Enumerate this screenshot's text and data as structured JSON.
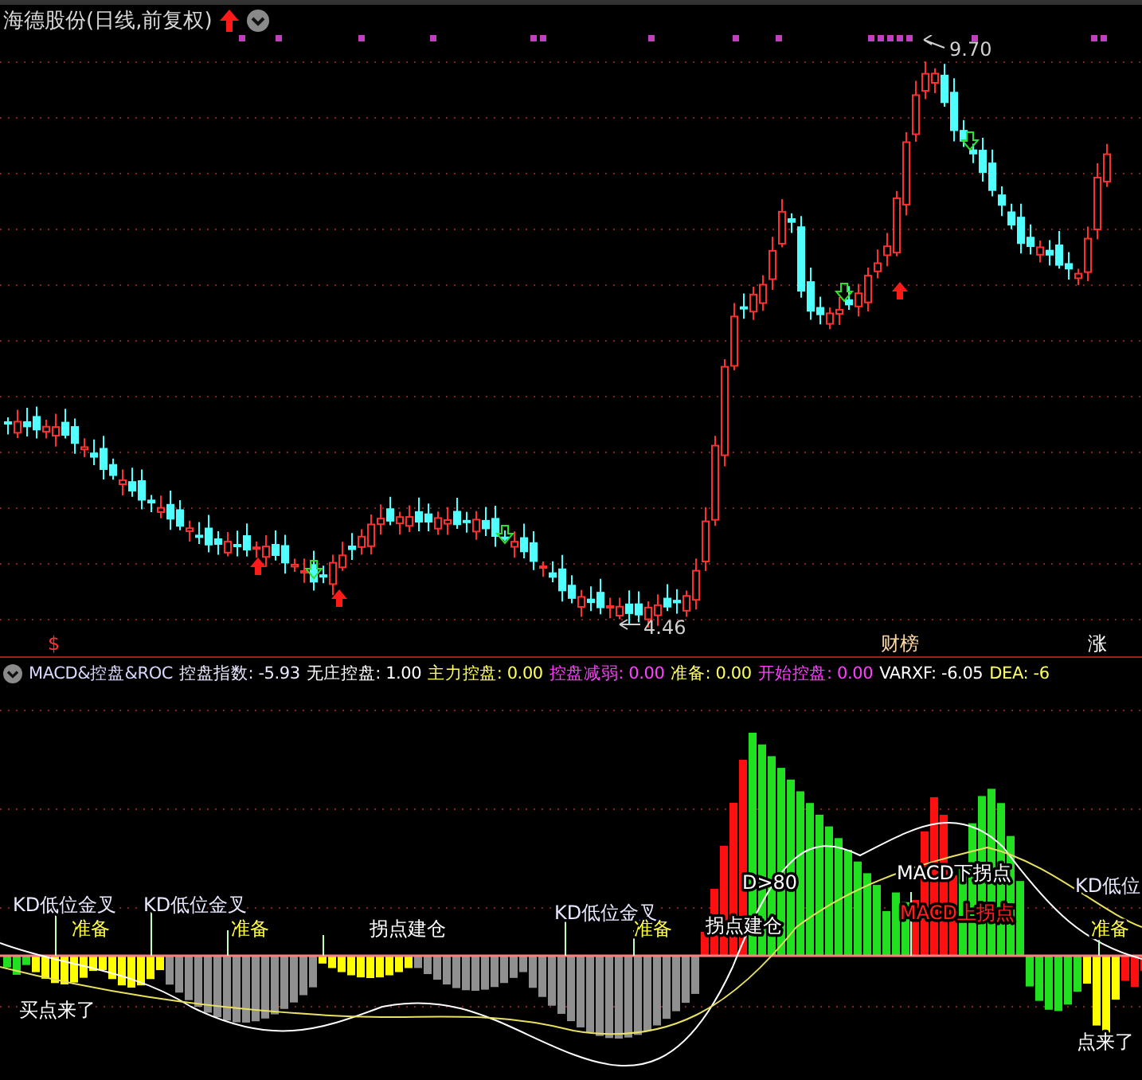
{
  "header": {
    "title": "海德股份(日线,前复权)"
  },
  "price_chart": {
    "high_label": "9.70",
    "low_label": "4.46",
    "event_marks": [
      {
        "text": "$",
        "color": "#ff3030"
      },
      {
        "text": "财榜",
        "color": "#ffd8a0"
      },
      {
        "text": "涨",
        "color": "#ffffff"
      }
    ]
  },
  "indicator": {
    "legend": [
      {
        "text": "MACD&控盘&ROC",
        "color": "#d8d8ff"
      },
      {
        "text": "控盘指数: -5.93",
        "color": "#e8e8ff"
      },
      {
        "text": "无庄控盘: 1.00",
        "color": "#ffffff"
      },
      {
        "text": "主力控盘: 0.00",
        "color": "#ffff60"
      },
      {
        "text": "控盘减弱: 0.00",
        "color": "#ff40ff"
      },
      {
        "text": "准备: 0.00",
        "color": "#ffff60"
      },
      {
        "text": "开始控盘: 0.00",
        "color": "#ff40ff"
      },
      {
        "text": "VARXF: -6.05",
        "color": "#ffffff"
      },
      {
        "text": "DEA: -6",
        "color": "#ffff60"
      }
    ],
    "annotations": [
      {
        "kind": "kd",
        "text": "KD低位金叉"
      },
      {
        "kind": "kd",
        "text": "KD低位金叉"
      },
      {
        "kind": "kd",
        "text": "KD低位金叉"
      },
      {
        "kind": "kd",
        "text": "KD低位"
      },
      {
        "kind": "ready",
        "text": "准备"
      },
      {
        "kind": "ready",
        "text": "准备"
      },
      {
        "kind": "ready",
        "text": "准备"
      },
      {
        "kind": "ready",
        "text": "准备"
      },
      {
        "kind": "plain",
        "text": "买点来了"
      },
      {
        "kind": "plain",
        "text": "拐点建仓"
      },
      {
        "kind": "plain",
        "text": "拐点建仓"
      },
      {
        "kind": "plain",
        "text": "D>80"
      },
      {
        "kind": "plain",
        "text": "MACD下拐点"
      },
      {
        "kind": "alert",
        "text": "MACD上拐点"
      },
      {
        "kind": "plain",
        "text": "点来了"
      }
    ]
  }
}
